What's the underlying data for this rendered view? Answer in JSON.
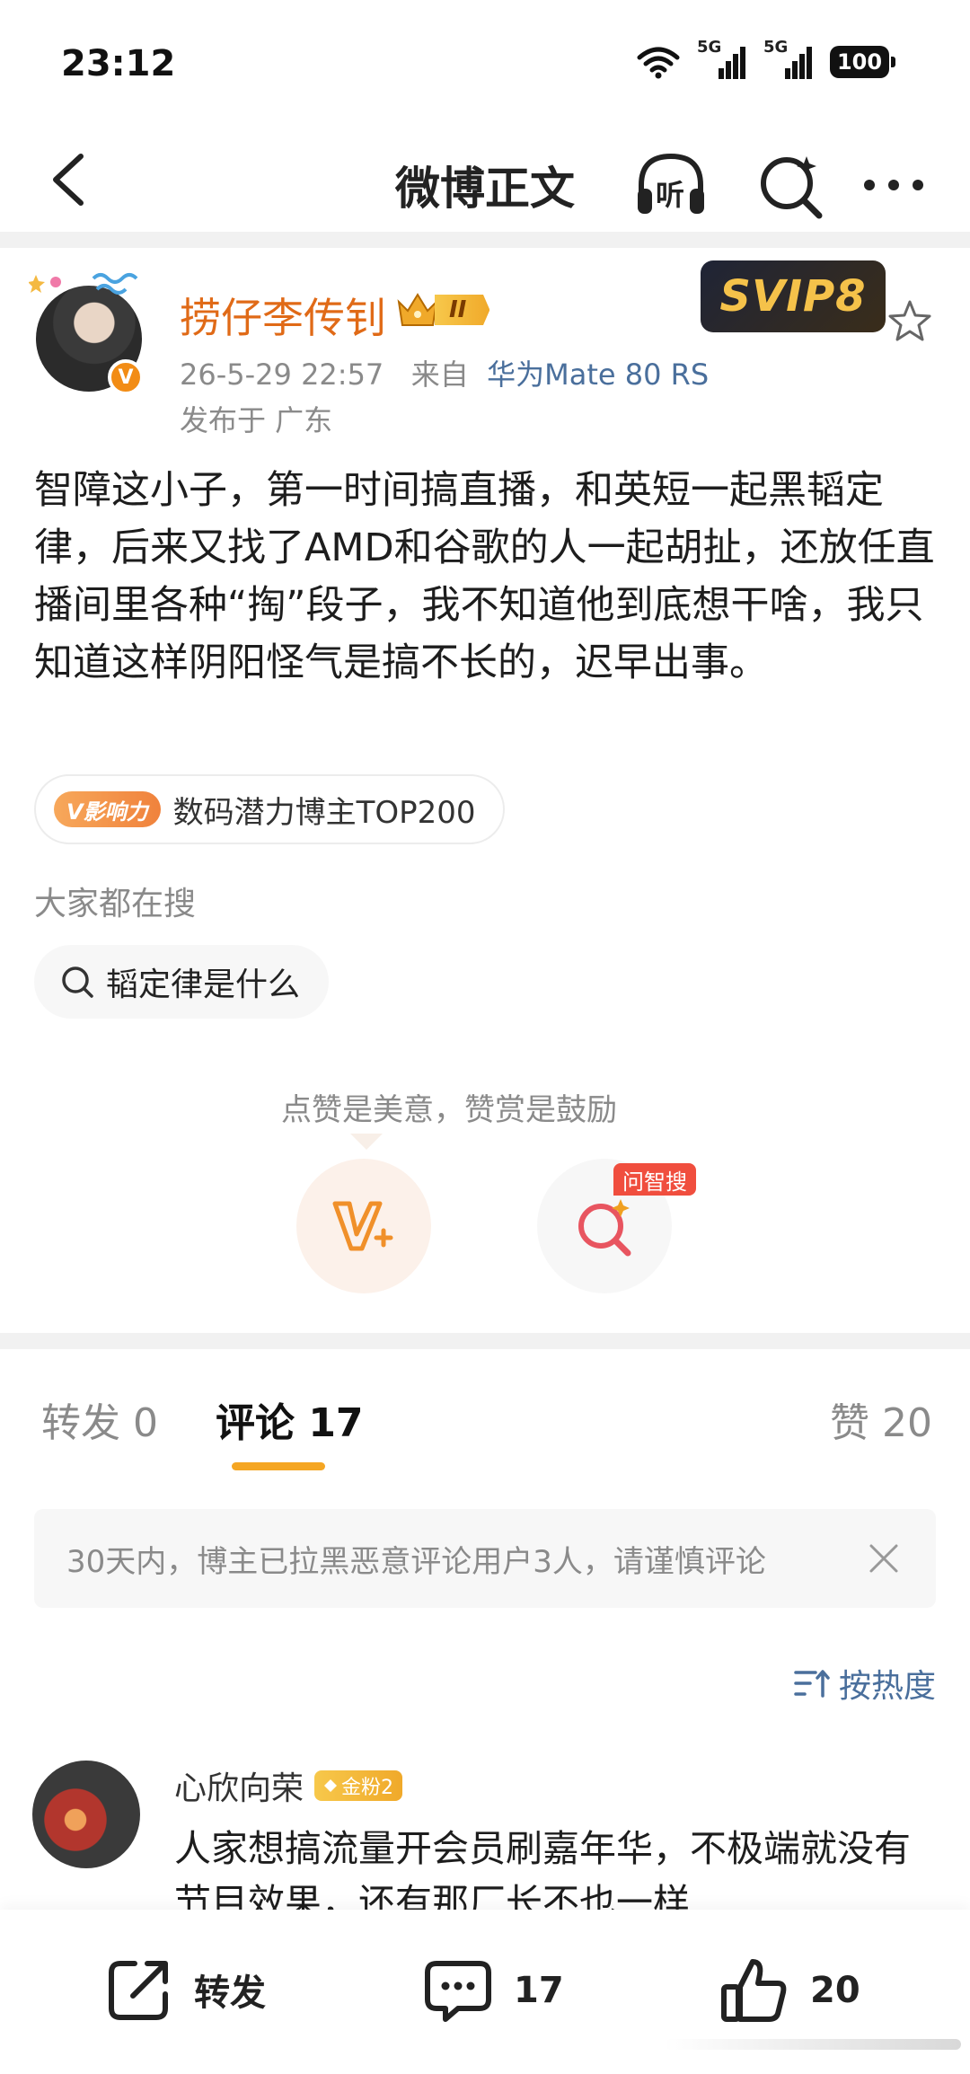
{
  "status_bar": {
    "time": "23:12",
    "signal_1": "5G",
    "signal_2": "5G",
    "battery": "100"
  },
  "nav": {
    "title": "微博正文",
    "listen_label": "听"
  },
  "post": {
    "author": "捞仔李传钊",
    "rank_level": "II",
    "svip_label": "SVIP8",
    "timestamp": "26-5-29 22:57",
    "source_prefix": "来自",
    "device": "华为Mate 80 RS",
    "location": "发布于 广东",
    "body": "智障这小子，第一时间搞直播，和英短一起黑韬定律，后来又找了AMD和谷歌的人一起胡扯，还放任直播间里各种“掏”段子，我不知道他到底想干啥，我只知道这样阴阳怪气是搞不长的，迟早出事。",
    "influence_badge": "V影响力",
    "influence_text": "数码潜力博主TOP200"
  },
  "trending": {
    "label": "大家都在搜",
    "chip": "韬定律是什么"
  },
  "reward": {
    "hint": "点赞是美意，赞赏是鼓励",
    "ask_tag": "问智搜"
  },
  "tabs": {
    "repost": "转发 0",
    "comment": "评论 17",
    "like": "赞 20"
  },
  "notice": {
    "text": "30天内，博主已拉黑恶意评论用户3人，请谨慎评论"
  },
  "sort": {
    "label": "按热度"
  },
  "comment": {
    "name": "心欣向荣",
    "fan_badge": "金粉2",
    "text": "人家想搞流量开会员刷嘉年华，不极端就没有节目效果，还有那厂长不也一样"
  },
  "bottom_bar": {
    "repost_label": "转发",
    "comment_count": "17",
    "like_count": "20"
  },
  "colors": {
    "accent": "#f5a623",
    "author": "#e06a17",
    "link": "#4a6f9c"
  }
}
